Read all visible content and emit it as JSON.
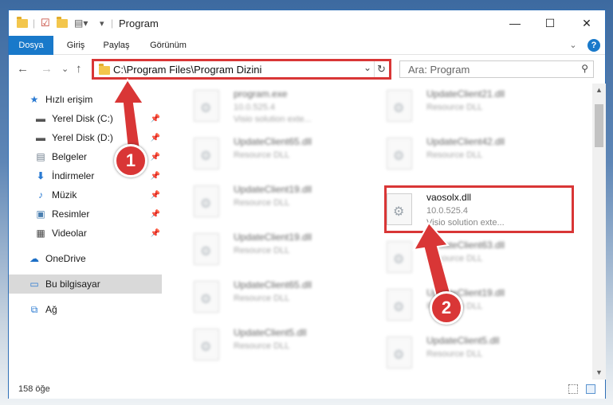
{
  "window": {
    "title": "Program",
    "controls": {
      "minimize": "—",
      "maximize": "☐",
      "close": "✕"
    }
  },
  "ribbon": {
    "tabs": [
      "Dosya",
      "Giriş",
      "Paylaş",
      "Görünüm"
    ],
    "expand_icon": "⌄",
    "help_icon": "?"
  },
  "nav": {
    "back": "←",
    "forward": "→",
    "recent": "⌄",
    "up": "↑",
    "address": "C:\\Program Files\\Program Dizini",
    "search_placeholder": "Ara: Program"
  },
  "sidebar": {
    "items": [
      {
        "label": "Hızlı erişim",
        "icon": "star-icon"
      },
      {
        "label": "Yerel Disk (C:)",
        "icon": "drive-icon",
        "pinned": true
      },
      {
        "label": "Yerel Disk (D:)",
        "icon": "drive-icon",
        "pinned": true
      },
      {
        "label": "Belgeler",
        "icon": "documents-icon",
        "pinned": true
      },
      {
        "label": "İndirmeler",
        "icon": "download-icon",
        "pinned": true
      },
      {
        "label": "Müzik",
        "icon": "music-icon",
        "pinned": true
      },
      {
        "label": "Resimler",
        "icon": "pictures-icon",
        "pinned": true
      },
      {
        "label": "Videolar",
        "icon": "video-icon",
        "pinned": true
      },
      {
        "label": "OneDrive",
        "icon": "cloud-icon"
      },
      {
        "label": "Bu bilgisayar",
        "icon": "computer-icon",
        "selected": true
      },
      {
        "label": "Ağ",
        "icon": "network-icon"
      }
    ]
  },
  "files": [
    {
      "name": "program.exe",
      "desc": "10.0.525.4",
      "desc2": "Visio solution exte..."
    },
    {
      "name": "UpdateClient21.dll",
      "desc": "Resource DLL"
    },
    {
      "name": "UpdateClient65.dll",
      "desc": "Resource DLL"
    },
    {
      "name": "UpdateClient42.dll",
      "desc": "Resource DLL"
    },
    {
      "name": "UpdateClient19.dll",
      "desc": "Resource DLL"
    },
    {
      "name": "vaosolx.dll",
      "desc": "10.0.525.4",
      "desc2": "Visio solution exte..."
    },
    {
      "name": "UpdateClient19.dll",
      "desc": "Resource DLL"
    },
    {
      "name": "UpdateClient63.dll",
      "desc": "Resource DLL"
    },
    {
      "name": "UpdateClient65.dll",
      "desc": "Resource DLL"
    },
    {
      "name": "UpdateClient19.dll",
      "desc": "Resource DLL"
    },
    {
      "name": "UpdateClient5.dll",
      "desc": "Resource DLL"
    },
    {
      "name": "UpdateClient5.dll",
      "desc": "Resource DLL"
    }
  ],
  "status": {
    "count": "158 öğe"
  },
  "callouts": {
    "one": "1",
    "two": "2"
  },
  "colors": {
    "accent": "#1979ca",
    "highlight": "#d93636"
  }
}
